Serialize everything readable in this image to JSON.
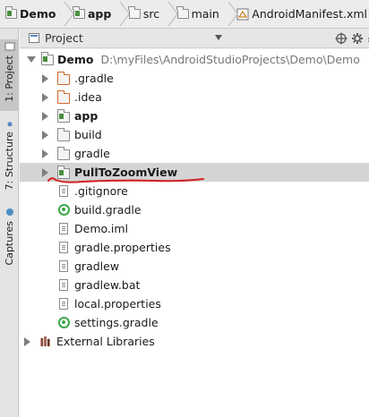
{
  "breadcrumb": [
    {
      "label": "Demo",
      "icon": "project-folder-icon",
      "bold": true
    },
    {
      "label": "app",
      "icon": "module-folder-icon",
      "bold": true
    },
    {
      "label": "src",
      "icon": "folder-icon",
      "bold": false
    },
    {
      "label": "main",
      "icon": "folder-icon",
      "bold": false
    },
    {
      "label": "AndroidManifest.xml",
      "icon": "manifest-file-icon",
      "bold": false
    }
  ],
  "tool_strip": {
    "tabs": [
      {
        "label": "1: Project",
        "active": true
      },
      {
        "label": "7: Structure",
        "active": false
      },
      {
        "label": "Captures",
        "active": false
      }
    ]
  },
  "panel": {
    "title": "Project"
  },
  "tree": {
    "root": {
      "label": "Demo",
      "path": "D:\\myFiles\\AndroidStudioProjects\\Demo\\Demo"
    },
    "items": [
      {
        "label": ".gradle",
        "icon": "orange-folder-icon",
        "expandable": true
      },
      {
        "label": ".idea",
        "icon": "orange-folder-icon",
        "expandable": true
      },
      {
        "label": "app",
        "icon": "module-folder-icon",
        "expandable": true,
        "bold": true
      },
      {
        "label": "build",
        "icon": "folder-icon",
        "expandable": true
      },
      {
        "label": "gradle",
        "icon": "folder-icon",
        "expandable": true
      },
      {
        "label": "PullToZoomView",
        "icon": "module-folder-icon",
        "expandable": true,
        "bold": true,
        "selected": true
      },
      {
        "label": ".gitignore",
        "icon": "text-file-icon"
      },
      {
        "label": "build.gradle",
        "icon": "gradle-icon"
      },
      {
        "label": "Demo.iml",
        "icon": "text-file-icon"
      },
      {
        "label": "gradle.properties",
        "icon": "properties-file-icon"
      },
      {
        "label": "gradlew",
        "icon": "text-file-icon"
      },
      {
        "label": "gradlew.bat",
        "icon": "text-file-icon"
      },
      {
        "label": "local.properties",
        "icon": "properties-file-icon"
      },
      {
        "label": "settings.gradle",
        "icon": "gradle-icon"
      }
    ],
    "external": {
      "label": "External Libraries"
    }
  },
  "colors": {
    "annotation_red": "#d42020",
    "orange_folder": "#d5692b",
    "gradle_green": "#3ba74a",
    "selection": "#d4d4d4"
  }
}
